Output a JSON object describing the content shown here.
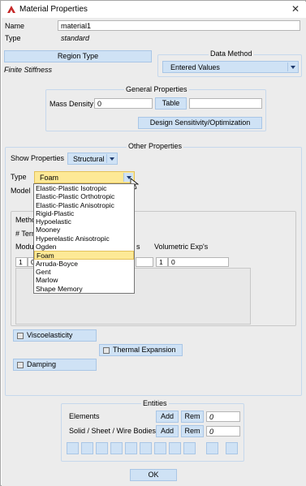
{
  "window": {
    "title": "Material Properties"
  },
  "name_label": "Name",
  "name_value": "material1",
  "type_label": "Type",
  "type_value": "standard",
  "region_type_button": "Region Type",
  "region_type_value": "Finite Stiffness",
  "data_method": {
    "title": "Data Method",
    "value": "Entered Values"
  },
  "general": {
    "title": "General Properties",
    "mass_density_label": "Mass Density",
    "mass_density_value": "0",
    "table_button": "Table",
    "design_button": "Design Sensitivity/Optimization"
  },
  "other": {
    "title": "Other Properties",
    "show_properties_label": "Show Properties",
    "show_properties_value": "Structural",
    "type_label": "Type",
    "type_value": "Foam",
    "model_label": "Model",
    "method_label": "Metho",
    "terms_label": "# Tern",
    "modulus_label": "Modul",
    "s_fragment": "s",
    "volumetric_label": "Volumetric Exp's",
    "row1_index": "1",
    "row1_value": "0",
    "row2_index": "1",
    "row2_value": "0",
    "viscoelasticity_label": "Viscoelasticity",
    "thermal_expansion_label": "Thermal Expansion",
    "damping_label": "Damping"
  },
  "type_options": [
    "Elastic-Plastic Isotropic",
    "Elastic-Plastic Orthotropic",
    "Elastic-Plastic Anisotropic",
    "Rigid-Plastic",
    "Hypoelastic",
    "Mooney",
    "Hyperelastic Anisotropic",
    "Ogden",
    "Foam",
    "Arruda-Boyce",
    "Gent",
    "Marlow",
    "Shape Memory"
  ],
  "entities": {
    "title": "Entities",
    "elements_label": "Elements",
    "bodies_label": "Solid / Sheet / Wire Bodies",
    "add_label": "Add",
    "rem_label": "Rem",
    "elements_count": "0",
    "bodies_count": "0"
  },
  "ok_label": "OK",
  "colors": {
    "accent_button": "#cfe2f5",
    "selection": "#fde996",
    "group_border": "#c6d8ec"
  }
}
